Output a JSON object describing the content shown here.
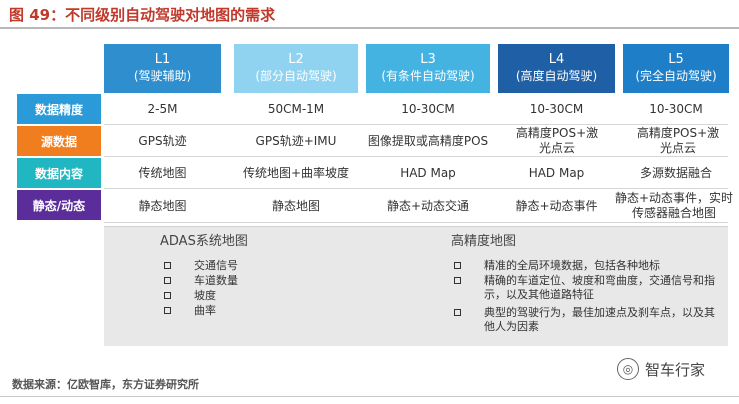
{
  "figure": {
    "title": "图 49：不同级别自动驾驶对地图的需求"
  },
  "levels": [
    {
      "name": "L1",
      "desc": "(驾驶辅助)",
      "bg": "#2e8ece",
      "fg": "#ffffff"
    },
    {
      "name": "L2",
      "desc": "(部分自动驾驶)",
      "bg": "#8fd3f0",
      "fg": "#ffffff"
    },
    {
      "name": "L3",
      "desc": "(有条件自动驾驶)",
      "bg": "#45b3e1",
      "fg": "#ffffff"
    },
    {
      "name": "L4",
      "desc": "(高度自动驾驶)",
      "bg": "#1f5fa5",
      "fg": "#ffffff"
    },
    {
      "name": "L5",
      "desc": "(完全自动驾驶)",
      "bg": "#1e7fc8",
      "fg": "#ffffff"
    }
  ],
  "rows": [
    {
      "label": "数据精度",
      "color": "#2a9bd8",
      "cells": [
        "2-5M",
        "50CM-1M",
        "10-30CM",
        "10-30CM",
        "10-30CM"
      ]
    },
    {
      "label": "源数据",
      "color": "#f07d1e",
      "cells": [
        "GPS轨迹",
        "GPS轨迹+IMU",
        "图像提取或高精度POS",
        "高精度POS+激光点云",
        "高精度POS+激光点云"
      ]
    },
    {
      "label": "数据内容",
      "color": "#21b7c2",
      "cells": [
        "传统地图",
        "传统地图+曲率坡度",
        "HAD Map",
        "HAD Map",
        "多源数据融合"
      ]
    },
    {
      "label": "静态/动态",
      "color": "#5a2d9a",
      "cells": [
        "静态地图",
        "静态地图",
        "静态+动态交通",
        "静态+动态事件",
        "静态+动态事件，实时传感器融合地图"
      ]
    }
  ],
  "adas": {
    "title": "ADAS系统地图",
    "items": [
      "交通信号",
      "车道数量",
      "坡度",
      "曲率"
    ]
  },
  "hd": {
    "title": "高精度地图",
    "items": [
      "精准的全局环境数据，包括各种地标",
      "精确的车道定位、坡度和弯曲度，交通信号和指示，以及其他道路特征",
      "典型的驾驶行为，最佳加速点及刹车点，以及其他人为因素"
    ]
  },
  "source": "数据来源：亿欧智库，东方证券研究所",
  "watermark": {
    "text": "智车行家",
    "icon": "wechat-icon"
  }
}
